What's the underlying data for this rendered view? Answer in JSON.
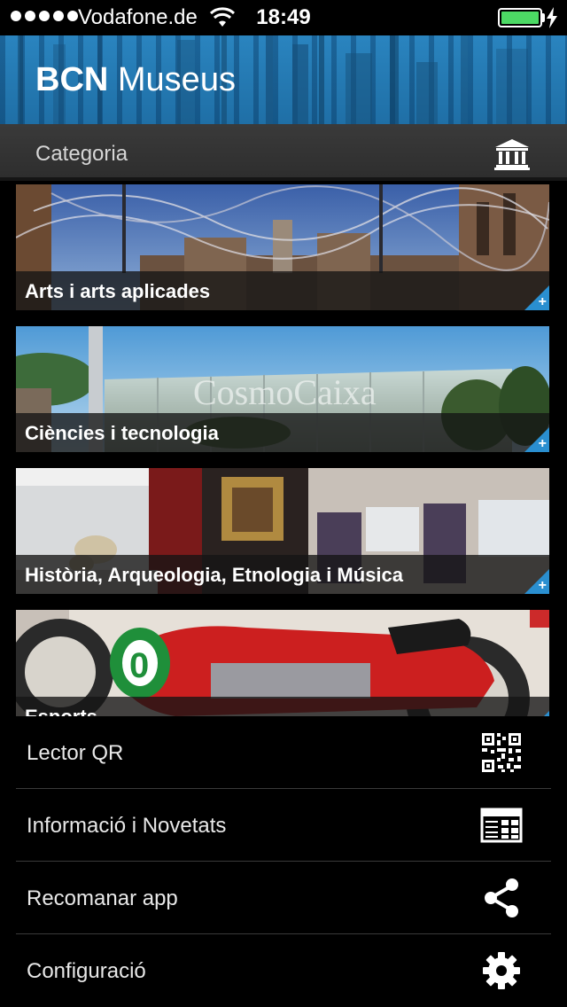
{
  "status_bar": {
    "carrier": "Vodafone.de",
    "time": "18:49",
    "battery_level": 1.0,
    "battery_color": "#4cd964"
  },
  "header": {
    "title_bold": "BCN",
    "title_rest": "Museus",
    "background_color": "#2a84bf"
  },
  "category_bar": {
    "label": "Categoria",
    "icon": "museum-icon"
  },
  "categories": [
    {
      "label": "Arts i arts aplicades",
      "expand_icon": "plus-icon"
    },
    {
      "label": "Ciències i tecnologia",
      "expand_icon": "plus-icon"
    },
    {
      "label": "Història, Arqueologia, Etnologia i Música",
      "expand_icon": "plus-icon"
    },
    {
      "label": "Esports",
      "expand_icon": "plus-icon"
    }
  ],
  "menu": [
    {
      "label": "Lector QR",
      "icon": "qr-code-icon"
    },
    {
      "label": "Informació i Novetats",
      "icon": "newspaper-icon"
    },
    {
      "label": "Recomanar app",
      "icon": "share-icon"
    },
    {
      "label": "Configuració",
      "icon": "gear-icon"
    }
  ],
  "accent_color": "#2a8fd0"
}
